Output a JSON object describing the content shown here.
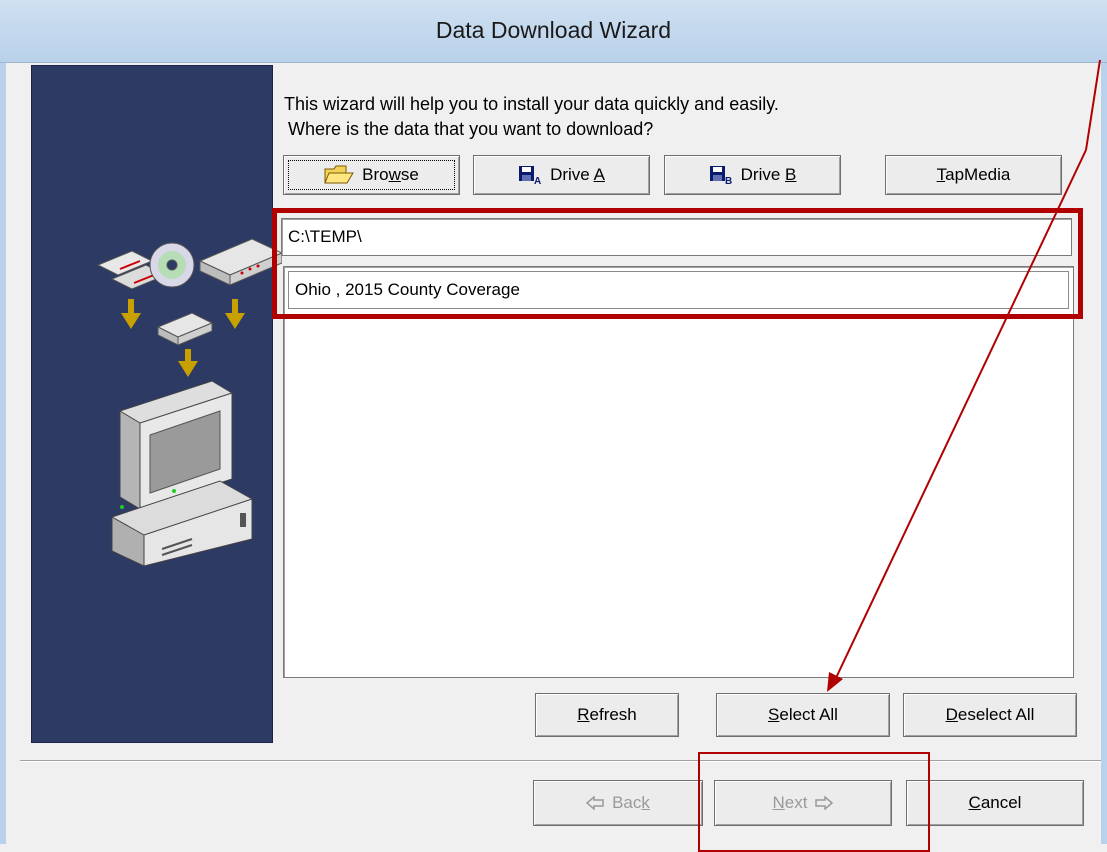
{
  "window": {
    "title": "Data Download Wizard"
  },
  "intro": {
    "line1": "This wizard will help you to install your data quickly and easily.",
    "line2": "Where is the data that you want to download?"
  },
  "source_buttons": {
    "browse": {
      "pre": "Bro",
      "key": "w",
      "post": "se"
    },
    "drive_a": {
      "pre": "Drive ",
      "key": "A"
    },
    "drive_b": {
      "pre": "Drive ",
      "key": "B"
    },
    "tapmedia": {
      "key": "T",
      "post": "apMedia"
    }
  },
  "path_field": {
    "value": "C:\\TEMP\\"
  },
  "data_list": {
    "items": [
      {
        "label": "Ohio ,  2015  County Coverage"
      }
    ]
  },
  "list_buttons": {
    "refresh": {
      "key": "R",
      "post": "efresh"
    },
    "select_all": {
      "key": "S",
      "post": "elect All"
    },
    "deselect_all": {
      "key": "D",
      "post": "eselect All"
    }
  },
  "nav_buttons": {
    "back": {
      "pre": "Bac",
      "key": "k",
      "disabled": true
    },
    "next": {
      "key": "N",
      "post": "ext",
      "disabled": true
    },
    "cancel": {
      "key": "C",
      "post": "ancel"
    }
  },
  "icons": {
    "drive_a": "floppy-disk-a-icon",
    "drive_b": "floppy-disk-b-icon",
    "browse": "open-folder-icon"
  },
  "colors": {
    "side_panel": "#2c3a64",
    "annotation": "#b00000",
    "icon_arrows": "#c8a000"
  }
}
